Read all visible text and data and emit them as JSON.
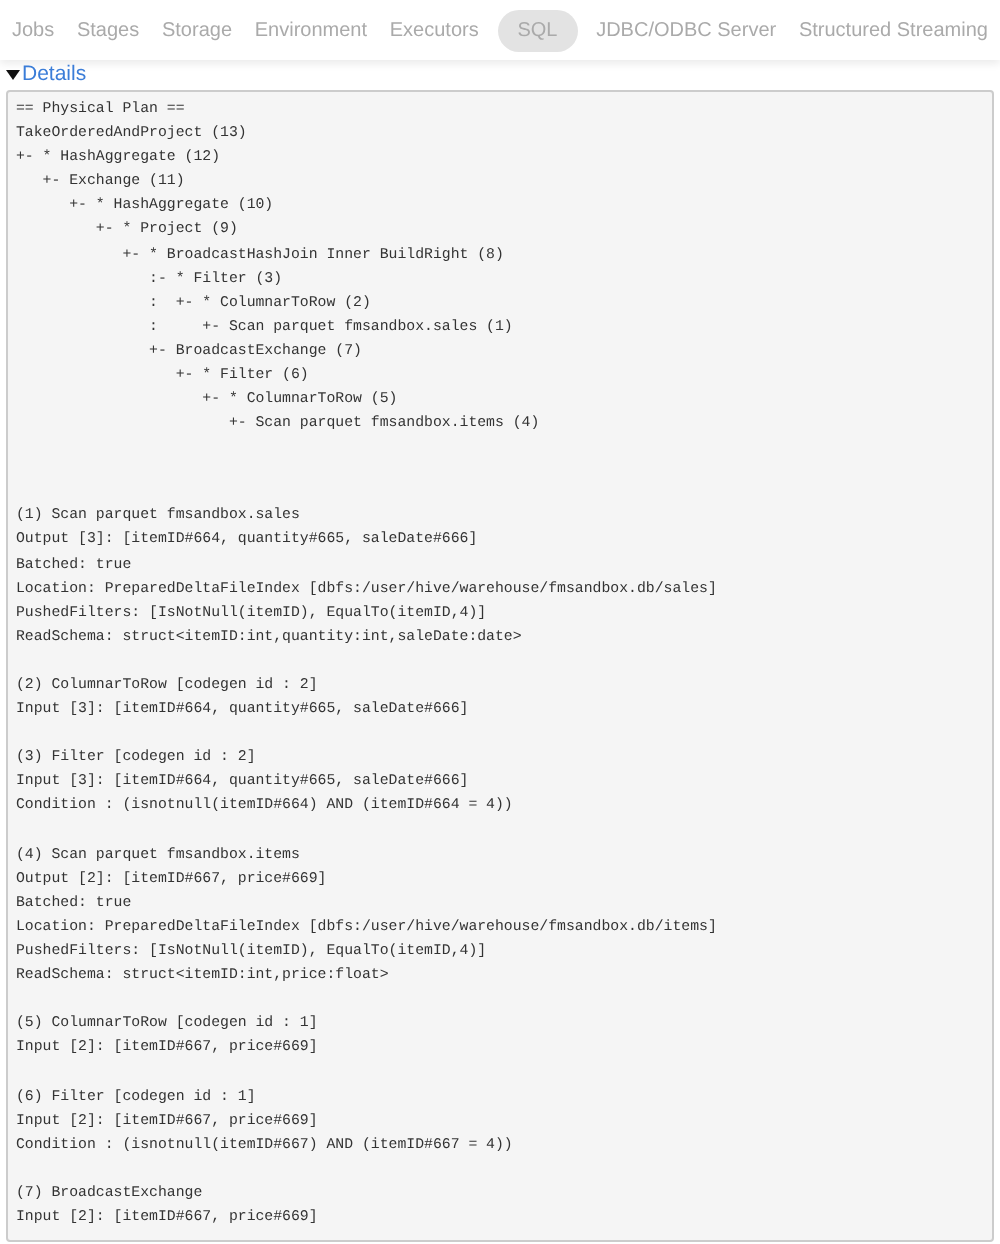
{
  "nav_tabs": [
    {
      "label": "Jobs",
      "selected": false
    },
    {
      "label": "Stages",
      "selected": false
    },
    {
      "label": "Storage",
      "selected": false
    },
    {
      "label": "Environment",
      "selected": false
    },
    {
      "label": "Executors",
      "selected": false
    },
    {
      "label": "SQL",
      "selected": true
    },
    {
      "label": "JDBC/ODBC Server",
      "selected": false
    },
    {
      "label": "Structured Streaming",
      "selected": false
    }
  ],
  "details": {
    "label": "Details",
    "expanded": true,
    "plan_lines": [
      "== Physical Plan ==",
      "TakeOrderedAndProject (13)",
      "+- * HashAggregate (12)",
      "   +- Exchange (11)",
      "      +- * HashAggregate (10)",
      "         +- * Project (9)",
      "            +- * BroadcastHashJoin Inner BuildRight (8)",
      "               :- * Filter (3)",
      "               :  +- * ColumnarToRow (2)",
      "               :     +- Scan parquet fmsandbox.sales (1)",
      "               +- BroadcastExchange (7)",
      "                  +- * Filter (6)",
      "                     +- * ColumnarToRow (5)",
      "                        +- Scan parquet fmsandbox.items (4)"
    ],
    "sections": [
      {
        "lines": [
          "(1) Scan parquet fmsandbox.sales",
          "Output [3]: [itemID#664, quantity#665, saleDate#666]",
          "Batched: true",
          "Location: PreparedDeltaFileIndex [dbfs:/user/hive/warehouse/fmsandbox.db/sales]",
          "PushedFilters: [IsNotNull(itemID), EqualTo(itemID,4)]",
          "ReadSchema: struct<itemID:int,quantity:int,saleDate:date>"
        ]
      },
      {
        "lines": [
          "(2) ColumnarToRow [codegen id : 2]",
          "Input [3]: [itemID#664, quantity#665, saleDate#666]"
        ]
      },
      {
        "lines": [
          "(3) Filter [codegen id : 2]",
          "Input [3]: [itemID#664, quantity#665, saleDate#666]",
          "Condition : (isnotnull(itemID#664) AND (itemID#664 = 4))"
        ]
      },
      {
        "lines": [
          "(4) Scan parquet fmsandbox.items",
          "Output [2]: [itemID#667, price#669]",
          "Batched: true",
          "Location: PreparedDeltaFileIndex [dbfs:/user/hive/warehouse/fmsandbox.db/items]",
          "PushedFilters: [IsNotNull(itemID), EqualTo(itemID,4)]",
          "ReadSchema: struct<itemID:int,price:float>"
        ]
      },
      {
        "lines": [
          "(5) ColumnarToRow [codegen id : 1]",
          "Input [2]: [itemID#667, price#669]"
        ]
      },
      {
        "lines": [
          "(6) Filter [codegen id : 1]",
          "Input [2]: [itemID#667, price#669]",
          "Condition : (isnotnull(itemID#667) AND (itemID#667 = 4))"
        ]
      },
      {
        "lines": [
          "(7) BroadcastExchange",
          "Input [2]: [itemID#667, price#669]"
        ]
      }
    ]
  }
}
